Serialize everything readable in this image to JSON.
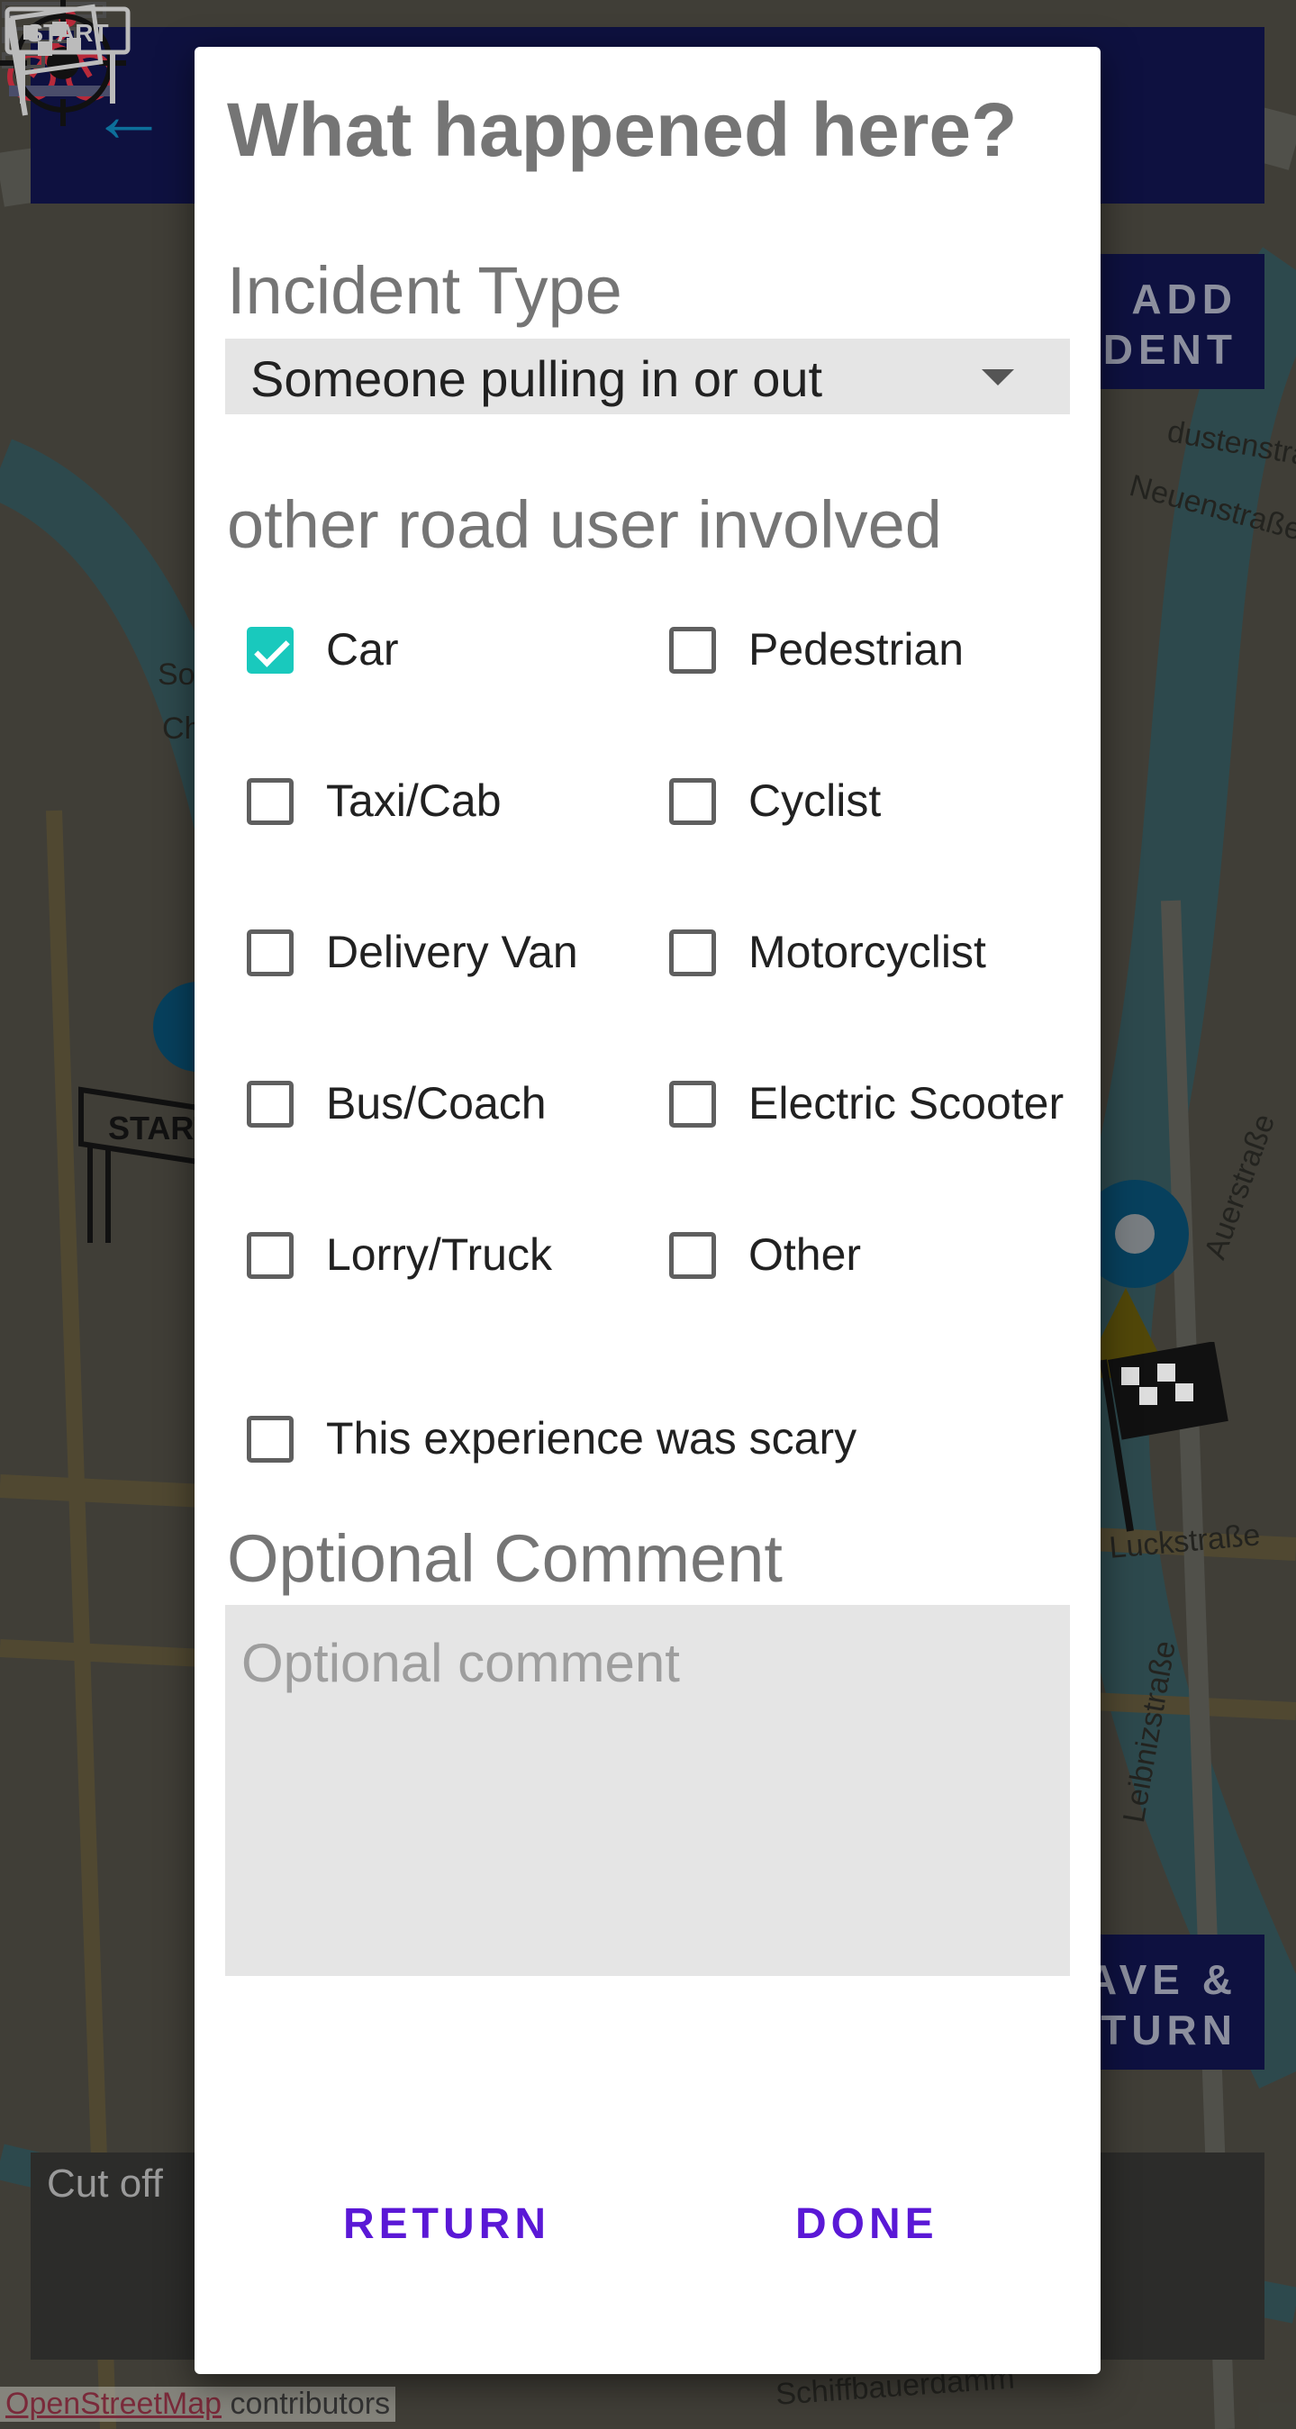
{
  "map": {
    "labels": [
      "Schiffbauerdamm",
      "Leibnizstraße",
      "Neuenstraße",
      "Auerstraße",
      "Luckstraße",
      "dustenstraße",
      "Cha",
      "So"
    ],
    "osm_link": "OpenStreetMap",
    "osm_suffix": " contributors",
    "start_sign_text": "START"
  },
  "app": {
    "add_incident": [
      "ADD",
      "INCIDENT"
    ],
    "save_return": [
      "SAVE &",
      "RETURN"
    ],
    "cutoff_label": "Cut off"
  },
  "dialog": {
    "title": "What happened here?",
    "incident_type_label": "Incident Type",
    "incident_type_value": "Someone pulling in or out",
    "road_user_label": "other road user involved",
    "road_users": [
      {
        "label": "Car",
        "checked": true
      },
      {
        "label": "Pedestrian",
        "checked": false
      },
      {
        "label": "Taxi/Cab",
        "checked": false
      },
      {
        "label": "Cyclist",
        "checked": false
      },
      {
        "label": "Delivery Van",
        "checked": false
      },
      {
        "label": "Motorcyclist",
        "checked": false
      },
      {
        "label": "Bus/Coach",
        "checked": false
      },
      {
        "label": "Electric Scooter",
        "checked": false
      },
      {
        "label": "Lorry/Truck",
        "checked": false
      },
      {
        "label": "Other",
        "checked": false
      }
    ],
    "scary": {
      "label": "This experience was scary",
      "checked": false
    },
    "comment_label": "Optional Comment",
    "comment_placeholder": "Optional comment",
    "return_label": "RETURN",
    "done_label": "DONE"
  },
  "colors": {
    "accent": "#19c9bd",
    "button_text": "#5a18d6",
    "app_bar": "#0e1140"
  }
}
